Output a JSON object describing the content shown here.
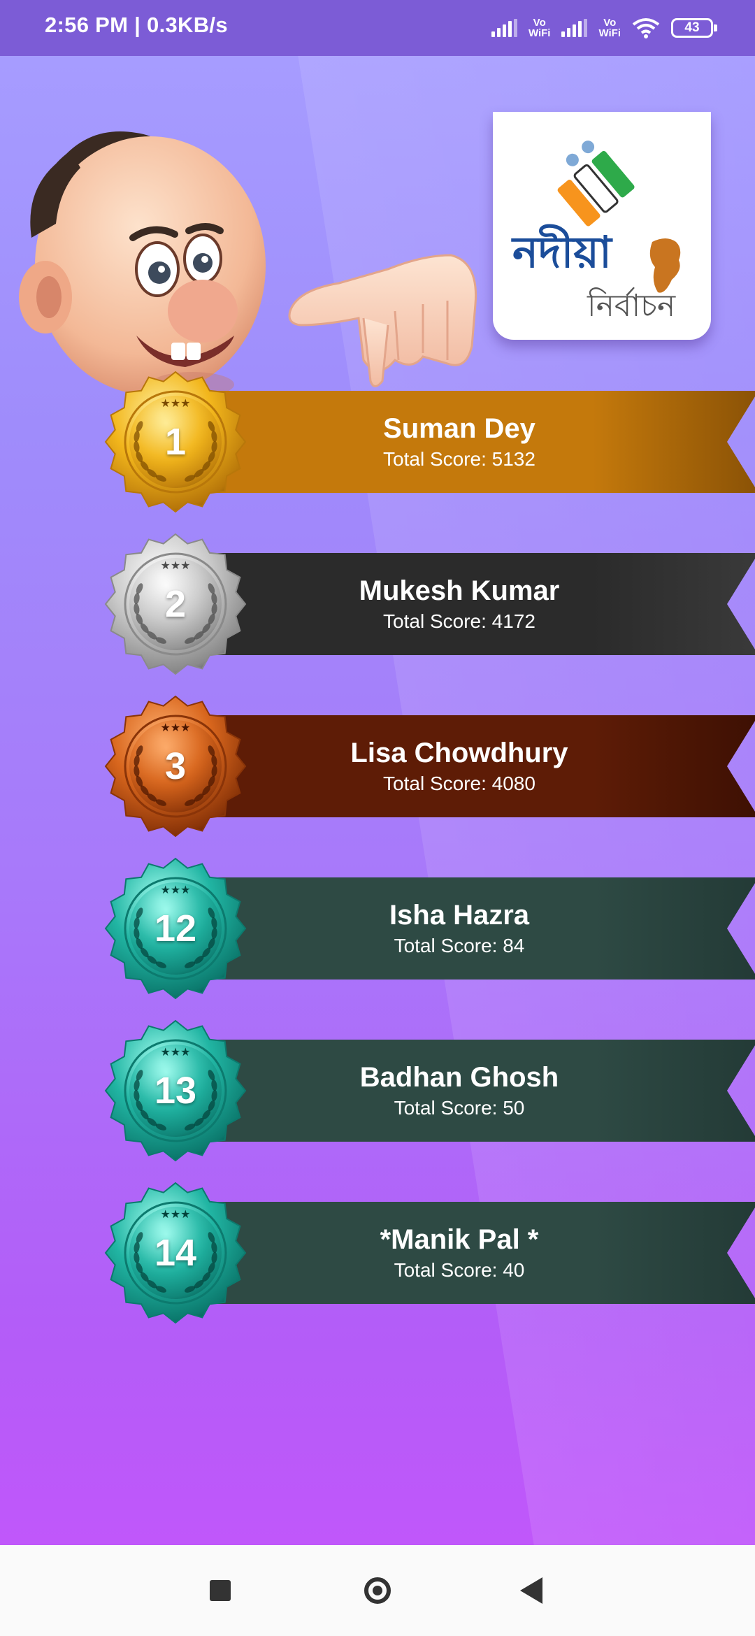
{
  "status_bar": {
    "time": "2:56 PM | 0.3KB/s",
    "vowifi_1": "Vo\nWiFi",
    "vowifi_2": "Vo\nWiFi",
    "battery": "43"
  },
  "logo": {
    "title_bengali": "নদীয়া",
    "subtitle_bengali": "নির্বাচন"
  },
  "leaderboard": [
    {
      "rank": "1",
      "name": "Suman Dey",
      "score_text": "Total Score: 5132",
      "medal": "gold",
      "color": "#c4790c"
    },
    {
      "rank": "2",
      "name": "Mukesh Kumar",
      "score_text": "Total Score: 4172",
      "medal": "silver",
      "color": "#2b2b2b"
    },
    {
      "rank": "3",
      "name": "Lisa Chowdhury",
      "score_text": "Total Score: 4080",
      "medal": "bronze",
      "color": "#5e1c06"
    },
    {
      "rank": "12",
      "name": "Isha Hazra",
      "score_text": "Total Score: 84",
      "medal": "teal",
      "color": "#2e4a44"
    },
    {
      "rank": "13",
      "name": "Badhan Ghosh",
      "score_text": "Total Score: 50",
      "medal": "teal",
      "color": "#2e4a44"
    },
    {
      "rank": "14",
      "name": "*Manik Pal *",
      "score_text": "Total Score: 40",
      "medal": "teal",
      "color": "#2e4a44"
    }
  ],
  "navigation": {
    "recents": "square-icon",
    "home": "circle-icon",
    "back": "triangle-back-icon"
  }
}
